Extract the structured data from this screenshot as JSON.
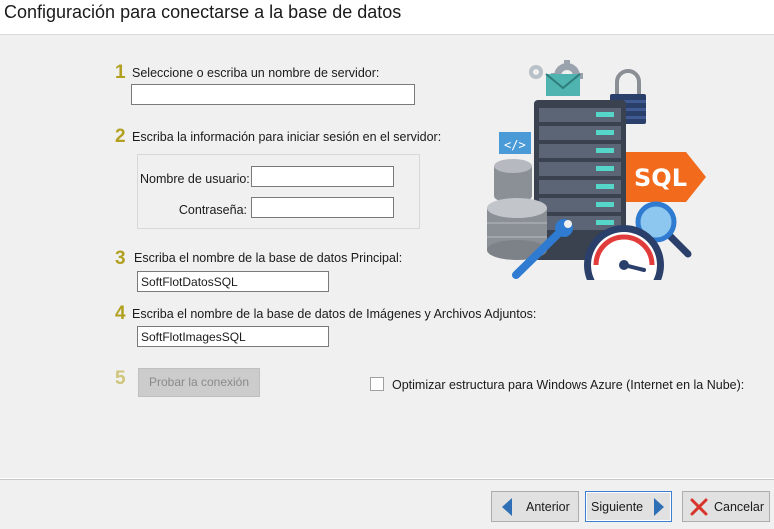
{
  "header": {
    "title": "Configuración para conectarse a la base de datos"
  },
  "steps": {
    "step1": {
      "number": "1",
      "label": "Seleccione o escriba un nombre de servidor:",
      "server_value": ""
    },
    "step2": {
      "number": "2",
      "label": "Escriba la información para iniciar sesión en el servidor:",
      "username_label": "Nombre de usuario:",
      "username_value": "",
      "password_label": "Contraseña:",
      "password_value": ""
    },
    "step3": {
      "number": "3",
      "label": "Escriba el nombre de la base de datos Principal:",
      "value": "SoftFlotDatosSQL"
    },
    "step4": {
      "number": "4",
      "label": "Escriba el nombre de la base de datos de Imágenes y Archivos Adjuntos:",
      "value": "SoftFlotImagesSQL"
    },
    "step5": {
      "number": "5",
      "test_button_label": "Probar la conexión",
      "test_button_enabled": false
    }
  },
  "azure_option": {
    "label": "Optimizar estructura para Windows Azure (Internet en la Nube):",
    "checked": false
  },
  "illustration": {
    "badge_text": "SQL",
    "icons": [
      "database-server-icon",
      "sql-tag-icon",
      "magnifier-icon",
      "gauge-icon",
      "padlock-icon",
      "gear-icon",
      "envelope-icon",
      "wrench-icon",
      "cylinder-database-icon"
    ]
  },
  "footer": {
    "back_label": "Anterior",
    "next_label": "Siguiente",
    "cancel_label": "Cancelar"
  },
  "colors": {
    "step_number": "#b2a021",
    "focus_border": "#3c7fd1",
    "arrow_blue": "#2f6fb5",
    "cancel_red": "#d9342b",
    "sql_orange": "#f26b1d"
  }
}
